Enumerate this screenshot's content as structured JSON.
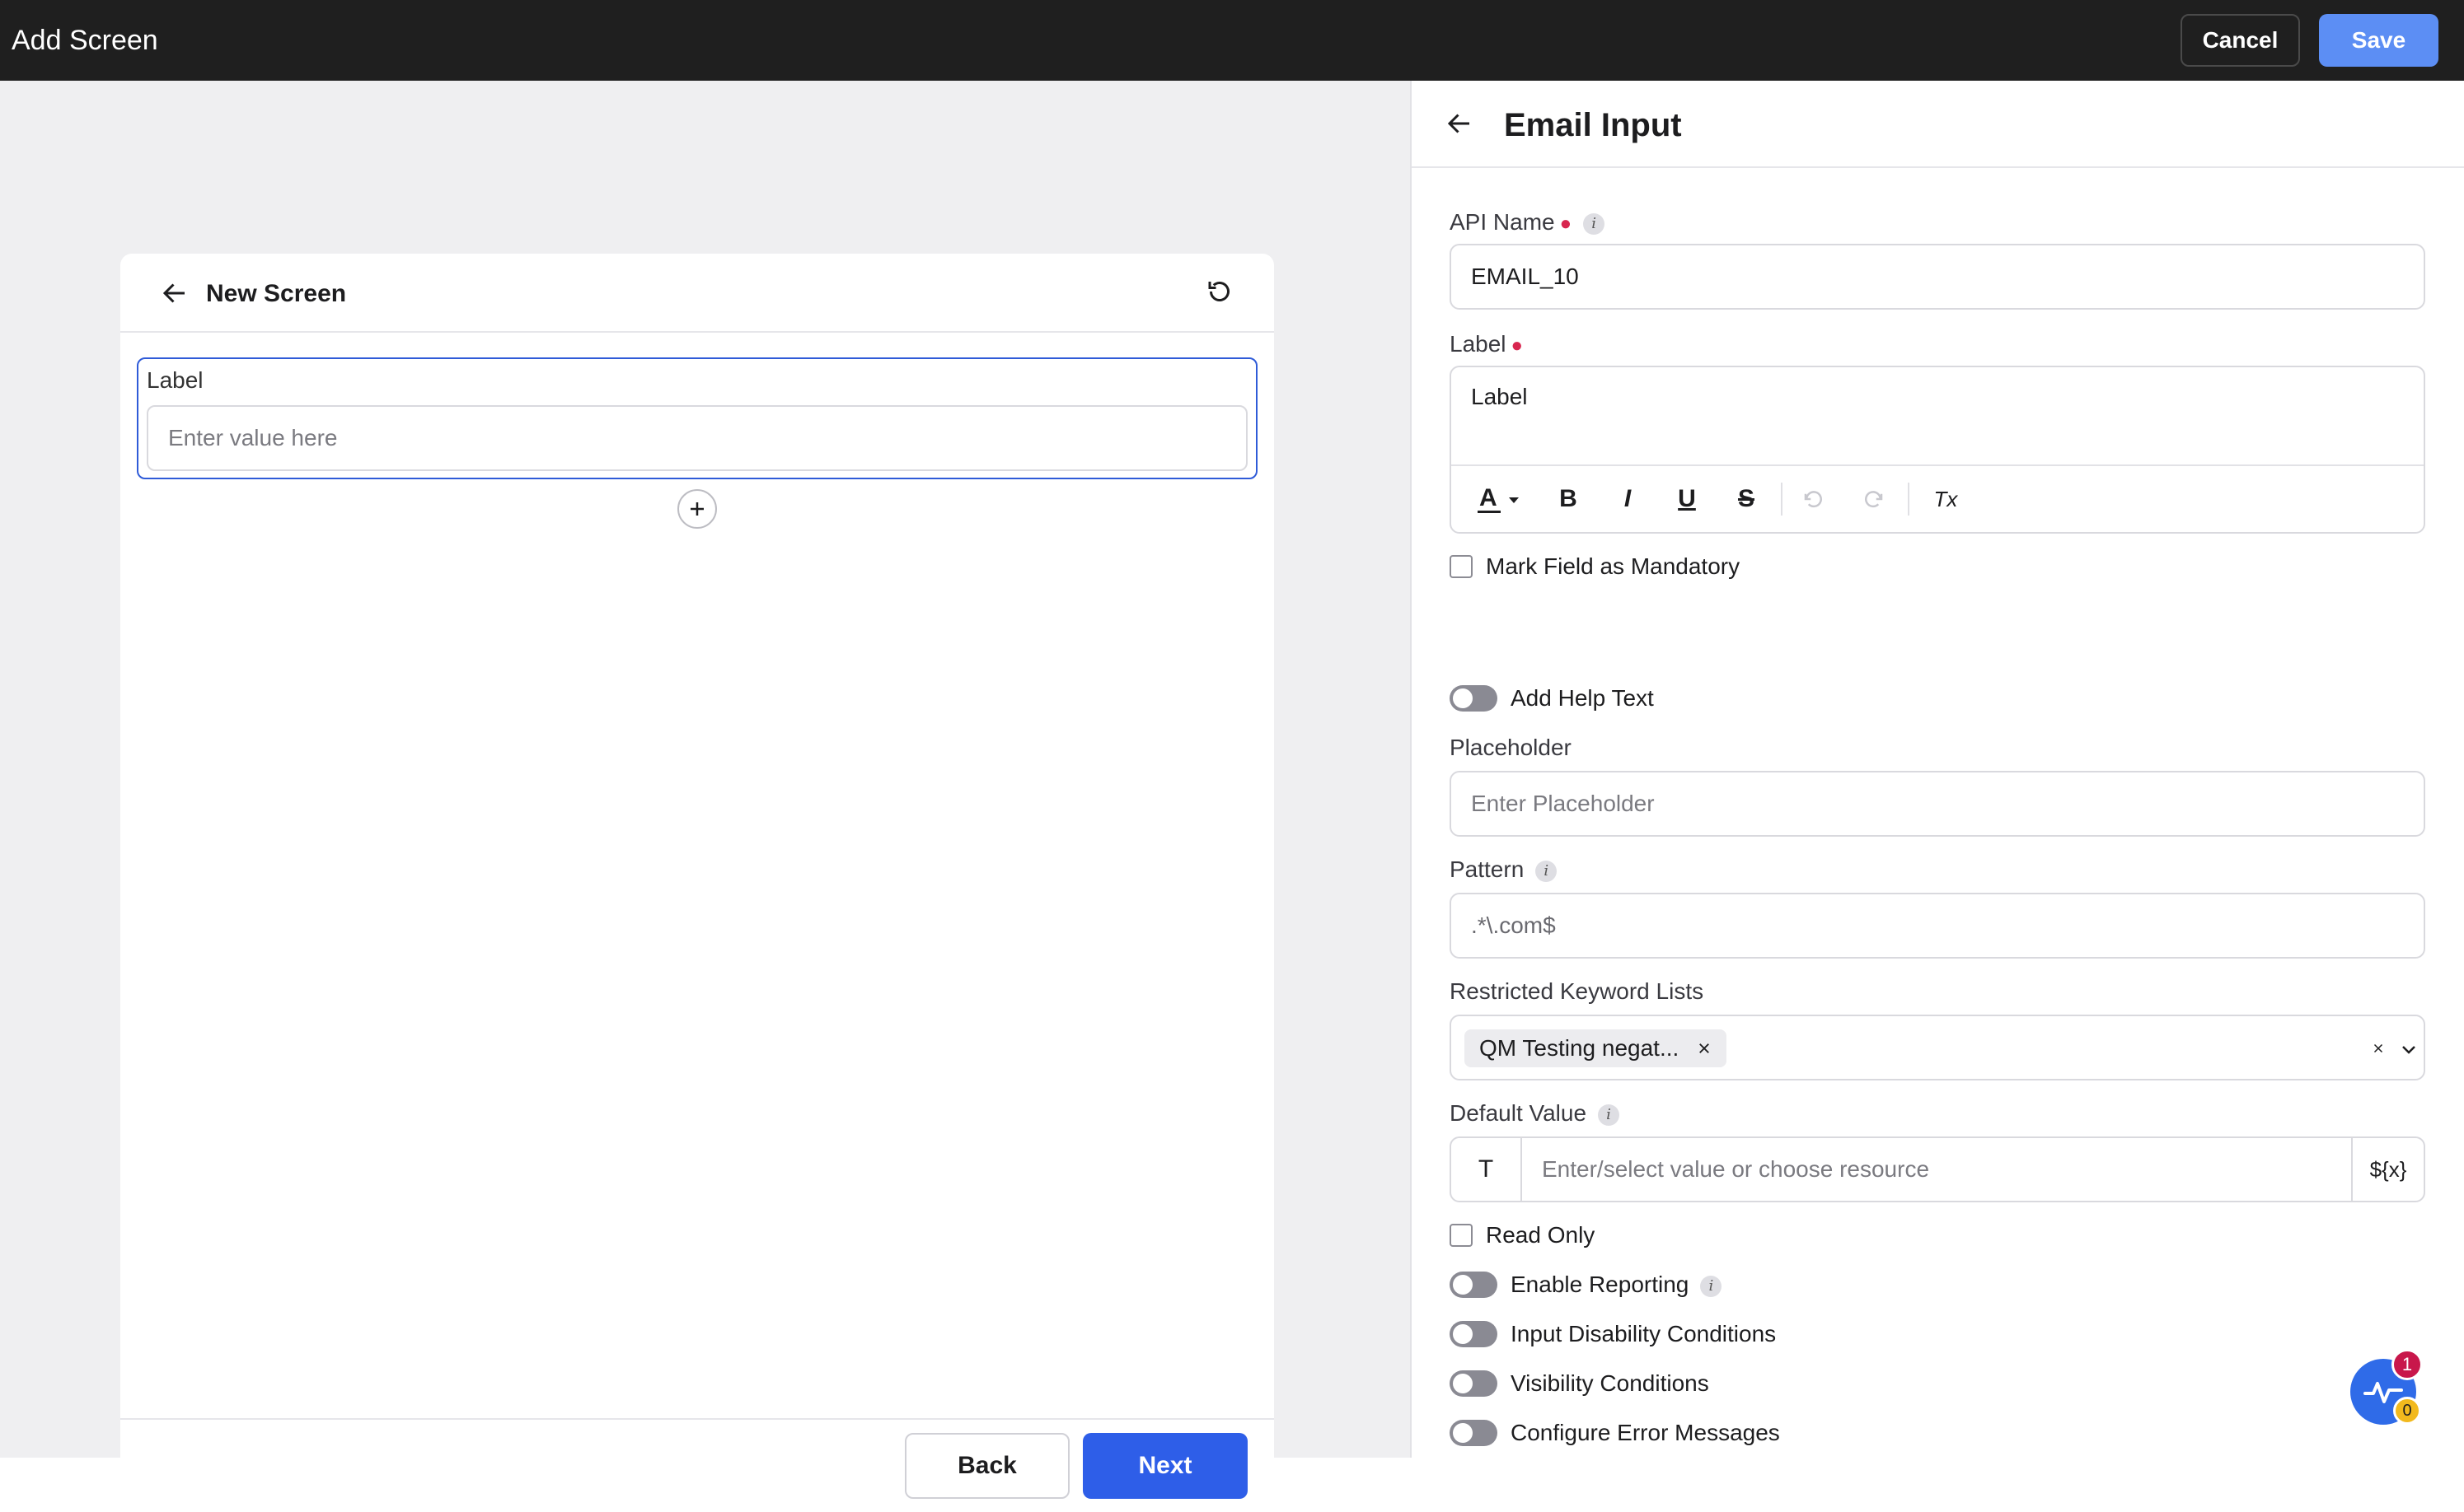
{
  "topbar": {
    "title": "Add Screen",
    "cancel_label": "Cancel",
    "save_label": "Save"
  },
  "preview": {
    "title": "New Screen",
    "field_label": "Label",
    "field_placeholder": "Enter value here",
    "back_label": "Back",
    "next_label": "Next"
  },
  "panel": {
    "title": "Email Input",
    "api_name_label": "API Name",
    "api_name_value": "EMAIL_10",
    "label_label": "Label",
    "label_value": "Label",
    "toolbar": {
      "bold": "B",
      "italic": "I",
      "underline": "U",
      "strike": "S",
      "clear": "Tx"
    },
    "mandatory_label": "Mark Field as Mandatory",
    "help_text_label": "Add Help Text",
    "placeholder_label": "Placeholder",
    "placeholder_placeholder": "Enter Placeholder",
    "pattern_label": "Pattern",
    "pattern_value": ".*\\.com$",
    "keywords_label": "Restricted Keyword Lists",
    "keyword_chip": "QM Testing negat...",
    "default_label": "Default Value",
    "default_type": "T",
    "default_placeholder": "Enter/select value or choose resource",
    "default_resource": "${x}",
    "read_only_label": "Read Only",
    "toggles": [
      "Enable Reporting",
      "Input Disability Conditions",
      "Visibility Conditions",
      "Configure Error Messages"
    ]
  },
  "fab": {
    "badge_red": "1",
    "badge_yellow": "0"
  },
  "colors": {
    "primary": "#2e5ee8",
    "save": "#5c8ef4",
    "required": "#d8264f",
    "topbar": "#1f1f1f"
  }
}
